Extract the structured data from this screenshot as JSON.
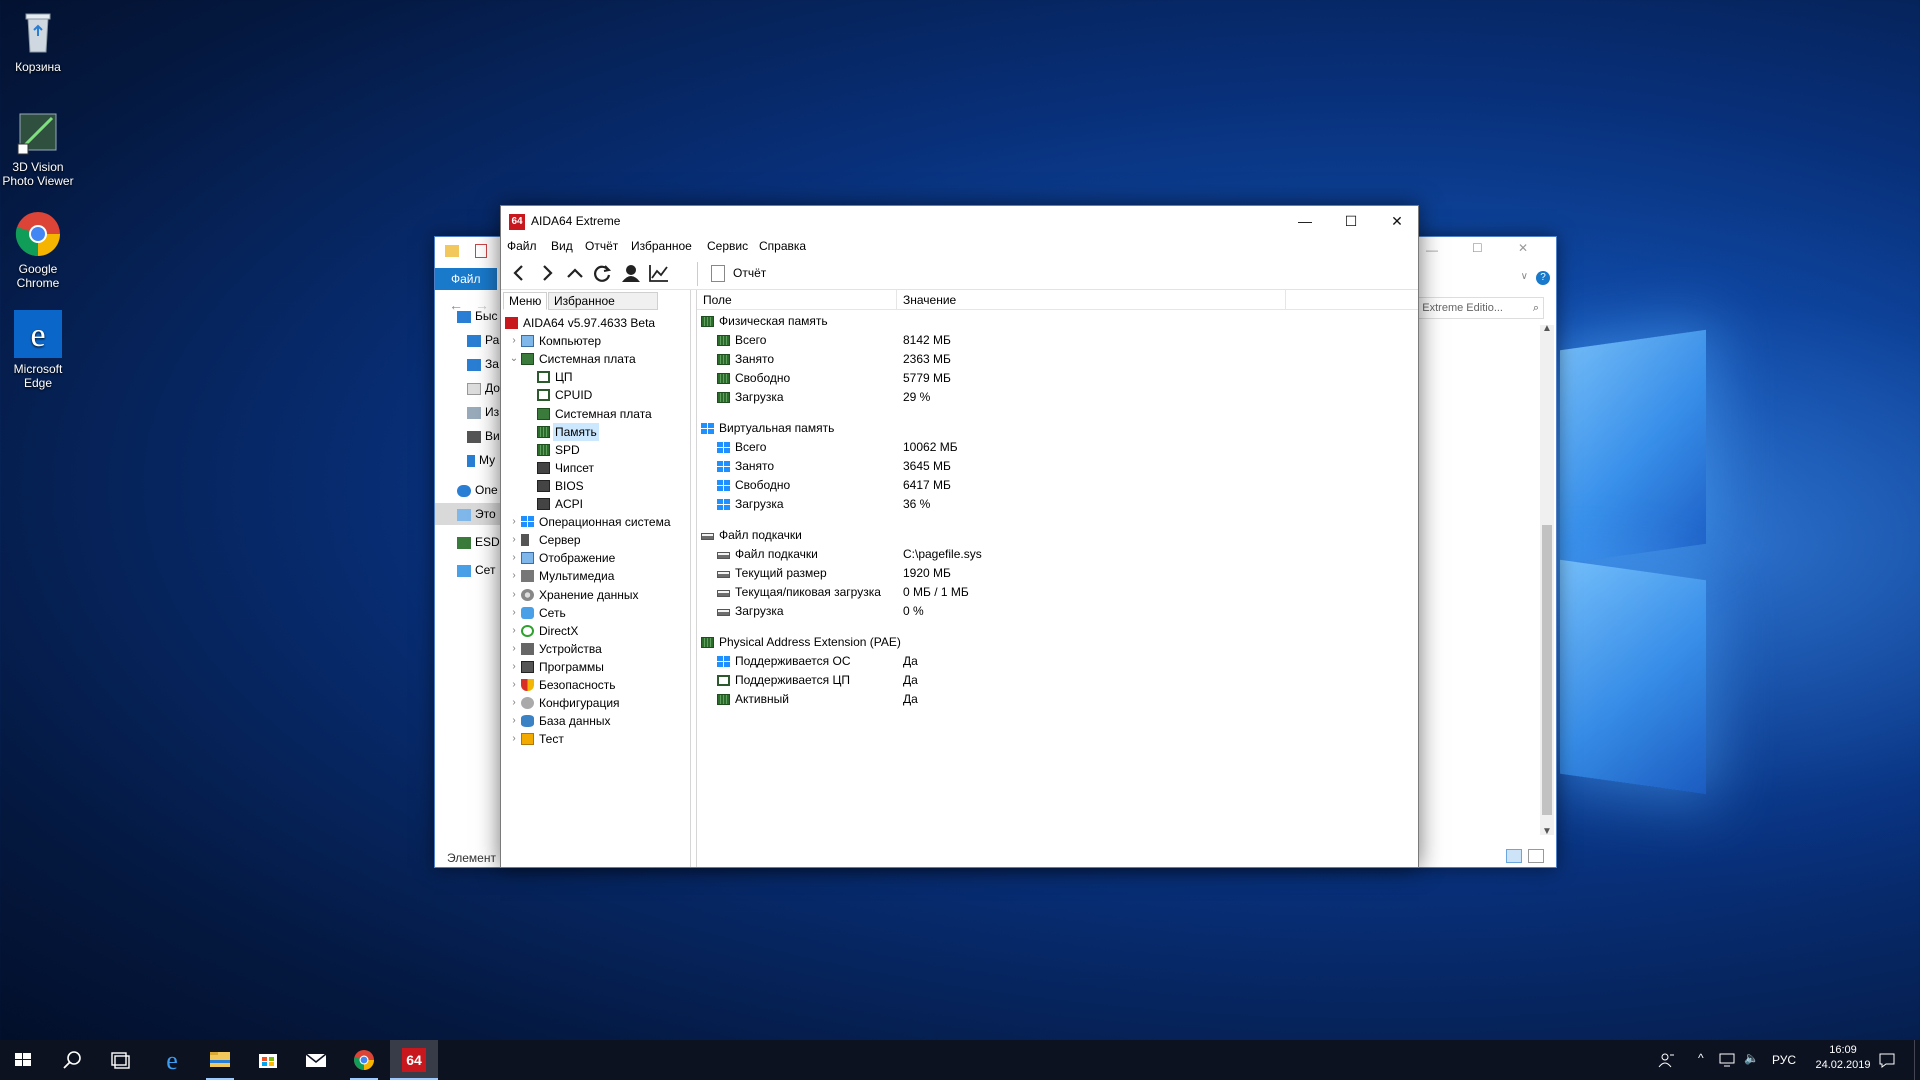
{
  "desktop": {
    "icons": [
      {
        "label": "Корзина"
      },
      {
        "label": "3D Vision Photo Viewer"
      },
      {
        "label": "Google Chrome"
      },
      {
        "label": "Microsoft Edge"
      }
    ]
  },
  "explorer": {
    "ribbon_tab": "Файл",
    "search_placeholder": "64 Extreme Editio...",
    "nav_items": [
      "Быс",
      "Ра",
      "За",
      "До",
      "Из",
      "Ви",
      "Му",
      "One",
      "Это",
      "ESD",
      "Сет"
    ],
    "status": "Элемент"
  },
  "aida": {
    "title": "AIDA64 Extreme",
    "app_badge": "64",
    "menu": [
      "Файл",
      "Вид",
      "Отчёт",
      "Избранное",
      "Сервис",
      "Справка"
    ],
    "report_button": "Отчёт",
    "tabs": [
      "Меню",
      "Избранное"
    ],
    "tree": [
      {
        "label": "AIDA64 v5.97.4633 Beta",
        "level": 0,
        "icon": "aida-icon",
        "expander": ""
      },
      {
        "label": "Компьютер",
        "level": 1,
        "icon": "computer-icon",
        "expander": ">"
      },
      {
        "label": "Системная плата",
        "level": 1,
        "icon": "motherboard-icon",
        "expander": "v"
      },
      {
        "label": "ЦП",
        "level": 2,
        "icon": "cpu-icon",
        "expander": ""
      },
      {
        "label": "CPUID",
        "level": 2,
        "icon": "cpuid-icon",
        "expander": ""
      },
      {
        "label": "Системная плата",
        "level": 2,
        "icon": "motherboard-icon",
        "expander": ""
      },
      {
        "label": "Память",
        "level": 2,
        "icon": "memory-icon",
        "expander": "",
        "selected": true
      },
      {
        "label": "SPD",
        "level": 2,
        "icon": "spd-icon",
        "expander": ""
      },
      {
        "label": "Чипсет",
        "level": 2,
        "icon": "chipset-icon",
        "expander": ""
      },
      {
        "label": "BIOS",
        "level": 2,
        "icon": "bios-icon",
        "expander": ""
      },
      {
        "label": "ACPI",
        "level": 2,
        "icon": "acpi-icon",
        "expander": ""
      },
      {
        "label": "Операционная система",
        "level": 1,
        "icon": "os-icon",
        "expander": ">"
      },
      {
        "label": "Сервер",
        "level": 1,
        "icon": "server-icon",
        "expander": ">"
      },
      {
        "label": "Отображение",
        "level": 1,
        "icon": "display-icon",
        "expander": ">"
      },
      {
        "label": "Мультимедиа",
        "level": 1,
        "icon": "multimedia-icon",
        "expander": ">"
      },
      {
        "label": "Хранение данных",
        "level": 1,
        "icon": "storage-icon",
        "expander": ">"
      },
      {
        "label": "Сеть",
        "level": 1,
        "icon": "network-icon",
        "expander": ">"
      },
      {
        "label": "DirectX",
        "level": 1,
        "icon": "directx-icon",
        "expander": ">"
      },
      {
        "label": "Устройства",
        "level": 1,
        "icon": "devices-icon",
        "expander": ">"
      },
      {
        "label": "Программы",
        "level": 1,
        "icon": "programs-icon",
        "expander": ">"
      },
      {
        "label": "Безопасность",
        "level": 1,
        "icon": "security-icon",
        "expander": ">"
      },
      {
        "label": "Конфигурация",
        "level": 1,
        "icon": "config-icon",
        "expander": ">"
      },
      {
        "label": "База данных",
        "level": 1,
        "icon": "database-icon",
        "expander": ">"
      },
      {
        "label": "Тест",
        "level": 1,
        "icon": "test-icon",
        "expander": ">"
      }
    ],
    "columns": [
      "Поле",
      "Значение"
    ],
    "rows": [
      {
        "type": "group",
        "field": "Физическая память",
        "value": "",
        "icon": "ram"
      },
      {
        "type": "item",
        "field": "Всего",
        "value": "8142 МБ",
        "icon": "ram"
      },
      {
        "type": "item",
        "field": "Занято",
        "value": "2363 МБ",
        "icon": "ram"
      },
      {
        "type": "item",
        "field": "Свободно",
        "value": "5779 МБ",
        "icon": "ram"
      },
      {
        "type": "item",
        "field": "Загрузка",
        "value": "29 %",
        "icon": "ram"
      },
      {
        "type": "spacer"
      },
      {
        "type": "group",
        "field": "Виртуальная память",
        "value": "",
        "icon": "win"
      },
      {
        "type": "item",
        "field": "Всего",
        "value": "10062 МБ",
        "icon": "win"
      },
      {
        "type": "item",
        "field": "Занято",
        "value": "3645 МБ",
        "icon": "win"
      },
      {
        "type": "item",
        "field": "Свободно",
        "value": "6417 МБ",
        "icon": "win"
      },
      {
        "type": "item",
        "field": "Загрузка",
        "value": "36 %",
        "icon": "win"
      },
      {
        "type": "spacer"
      },
      {
        "type": "group",
        "field": "Файл подкачки",
        "value": "",
        "icon": "disk"
      },
      {
        "type": "item",
        "field": "Файл подкачки",
        "value": "C:\\pagefile.sys",
        "icon": "disk"
      },
      {
        "type": "item",
        "field": "Текущий размер",
        "value": "1920 МБ",
        "icon": "disk"
      },
      {
        "type": "item",
        "field": "Текущая/пиковая загрузка",
        "value": "0 МБ / 1 МБ",
        "icon": "disk"
      },
      {
        "type": "item",
        "field": "Загрузка",
        "value": "0 %",
        "icon": "disk"
      },
      {
        "type": "spacer"
      },
      {
        "type": "group",
        "field": "Physical Address Extension (PAE)",
        "value": "",
        "icon": "ram"
      },
      {
        "type": "item",
        "field": "Поддерживается ОС",
        "value": "Да",
        "icon": "win"
      },
      {
        "type": "item",
        "field": "Поддерживается ЦП",
        "value": "Да",
        "icon": "chip"
      },
      {
        "type": "item",
        "field": "Активный",
        "value": "Да",
        "icon": "ram"
      }
    ]
  },
  "taskbar": {
    "language": "РУС",
    "time": "16:09",
    "date": "24.02.2019",
    "aida_badge": "64"
  }
}
